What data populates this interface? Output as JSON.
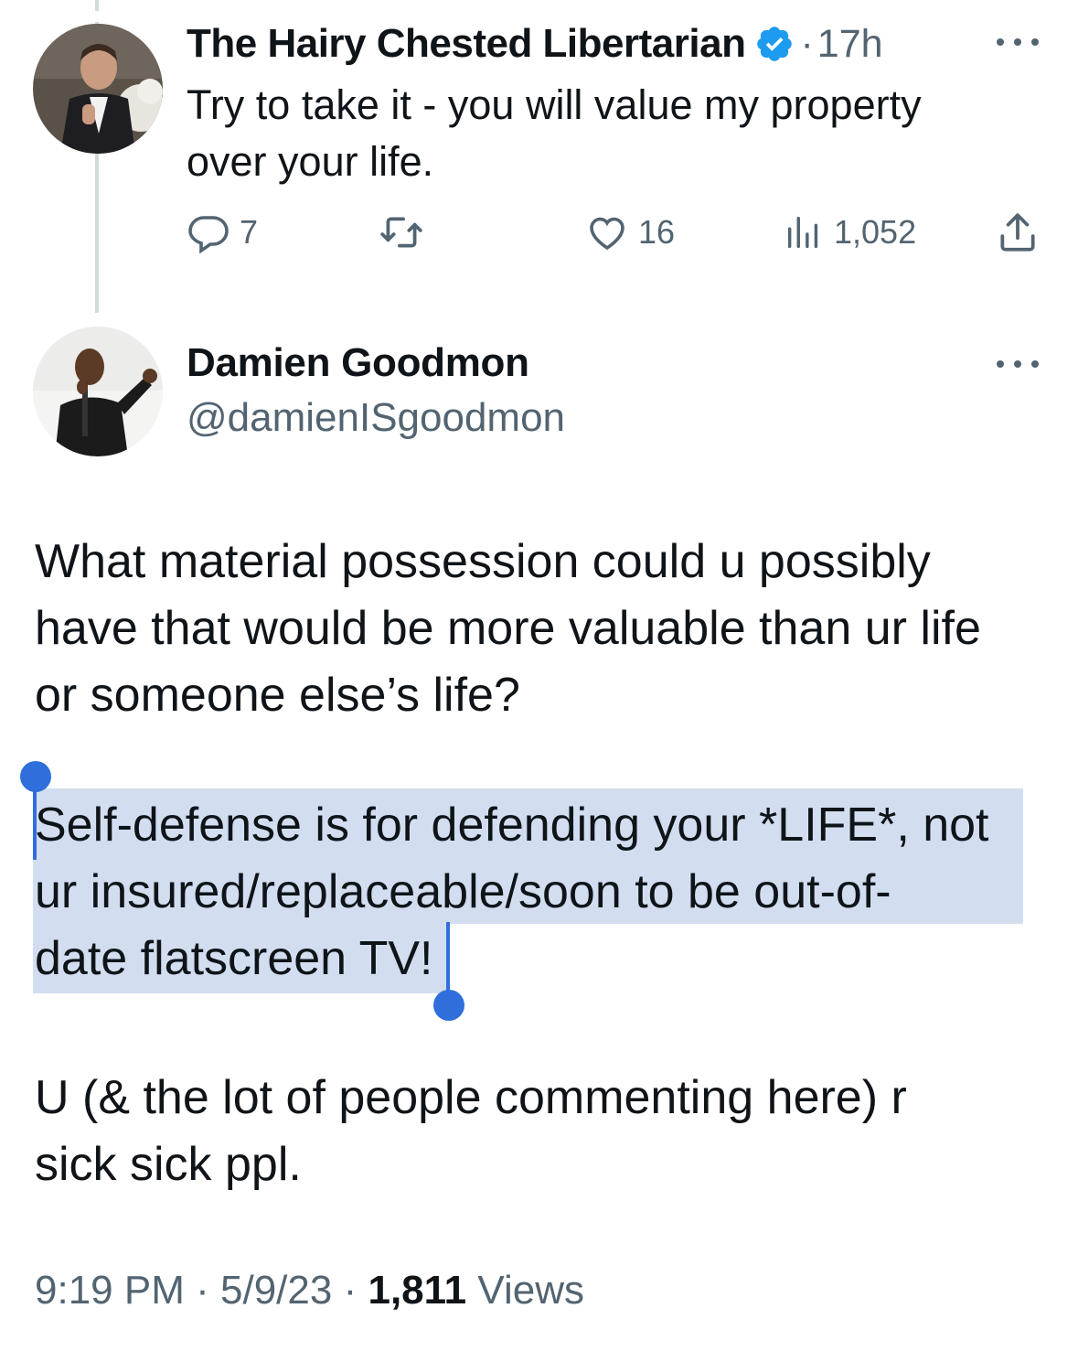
{
  "parent_tweet": {
    "author_name": "The Hairy Chested Libertarian",
    "verified": true,
    "separator": "·",
    "time_ago": "17h",
    "text_line1": "Try to take it - you will value my property",
    "text_line2": "over your life.",
    "stats": {
      "replies": "7",
      "retweets": "",
      "likes": "16",
      "views": "1,052"
    }
  },
  "reply_tweet": {
    "author_name": "Damien Goodmon",
    "handle": "@damienISgoodmon",
    "paragraph1_line1": "What material possession could u possibly",
    "paragraph1_line2": "have that would be more valuable than ur life",
    "paragraph1_line3": "or someone else’s life?",
    "paragraph2_line1": "Self-defense is for defending your *LIFE*, not",
    "paragraph2_line2": "ur insured/replaceable/soon to be out-of-",
    "paragraph2_line3": "date flatscreen TV!",
    "paragraph3_line1": "U (& the lot of people commenting here) r",
    "paragraph3_line2": "sick sick ppl.",
    "footer": {
      "time": "9:19 PM",
      "separator1": "·",
      "date": "5/9/23",
      "separator2": "·",
      "views_count": "1,811",
      "views_label": "Views"
    }
  },
  "colors": {
    "text_primary": "#0f1419",
    "text_secondary": "#536471",
    "verified_blue": "#1d9bf0",
    "selection_highlight": "#d2def0",
    "selection_handle": "#2e6fdc",
    "thread_line": "#cfd9de"
  },
  "icons": {
    "reply": "reply-icon",
    "retweet": "retweet-icon",
    "like": "heart-icon",
    "views": "bar-chart-icon",
    "share": "share-icon",
    "more": "more-icon",
    "verified": "verified-badge-icon"
  }
}
